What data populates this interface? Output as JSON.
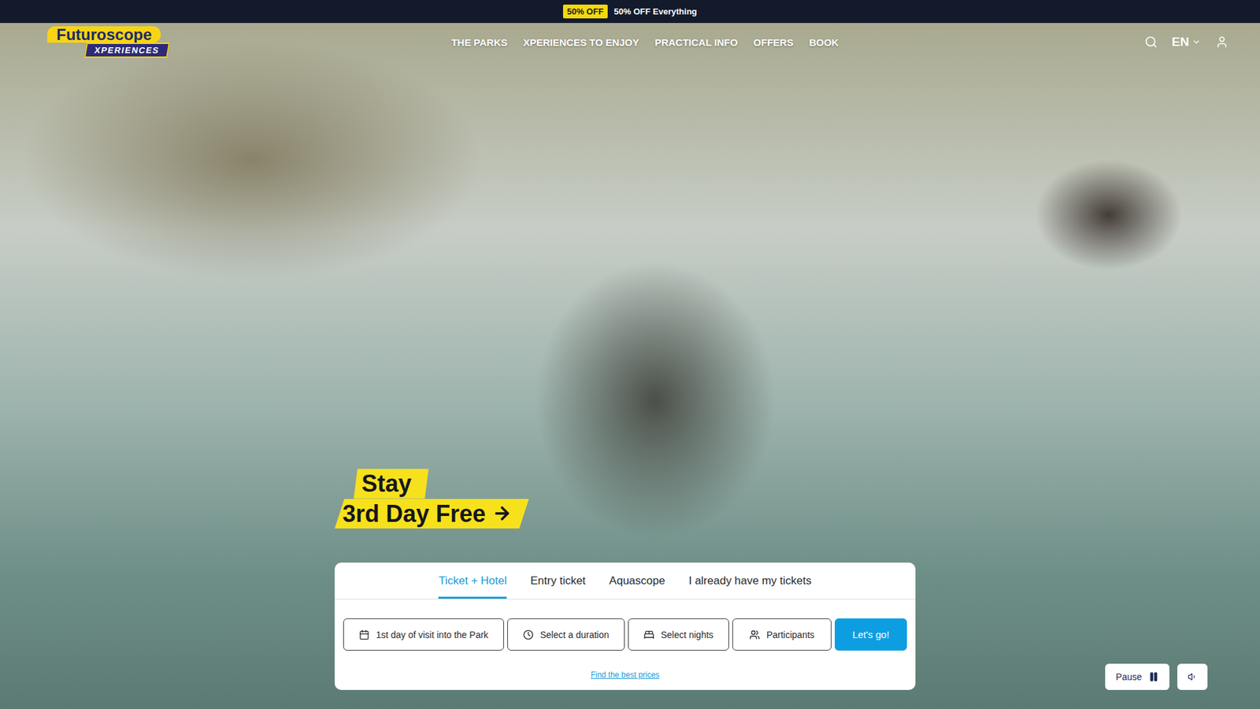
{
  "banner": {
    "badge": "50% OFF",
    "text": "50% OFF Everything"
  },
  "logo": {
    "name": "Futuroscope",
    "sub": "XPERIENCES"
  },
  "nav": {
    "items": [
      "THE PARKS",
      "XPERIENCES TO ENJOY",
      "PRACTICAL INFO",
      "OFFERS",
      "BOOK"
    ],
    "language": "EN"
  },
  "promo": {
    "lines": [
      "Stay",
      "3rd Day Free"
    ]
  },
  "booking": {
    "tabs": [
      {
        "label": "Ticket + Hotel",
        "selected": true
      },
      {
        "label": "Entry ticket",
        "selected": false
      },
      {
        "label": "Aquascope",
        "selected": false
      },
      {
        "label": "I already have my tickets",
        "selected": false
      }
    ],
    "fields": [
      "1st day of visit into the Park",
      "Select a duration",
      "Select nights",
      "Participants"
    ],
    "submit": "Let's go!",
    "link": "Find the best prices"
  },
  "video_controls": {
    "pause": "Pause"
  }
}
